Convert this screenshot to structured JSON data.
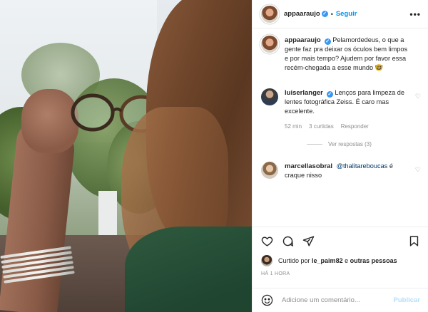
{
  "photo": {
    "alt": ""
  },
  "post": {
    "author": "appaaraujo",
    "follow_label": "Seguir",
    "more": "•••",
    "separator": "•"
  },
  "comments": [
    {
      "user": "appaaraujo",
      "text": "Pelamordedeus, o que a gente faz pra deixar os óculos bem limpos e por mais tempo? Ajudem por favor essa recém-chegada a esse mundo",
      "emoji": "🤓"
    },
    {
      "user": "luiserlanger",
      "text": "Lenços para limpeza de lentes fotográfica Zeiss. É caro mas excelente.",
      "time": "52 min",
      "likes": "3 curtidas",
      "reply": "Responder",
      "view_replies": "Ver respostas (3)"
    },
    {
      "user": "marcellasobral",
      "mention": "@thalitareboucas",
      "text": "é craque nisso"
    }
  ],
  "liked_by": {
    "prefix": "Curtido por",
    "user": "le_paim82",
    "suffix": "e",
    "others": "outras pessoas"
  },
  "timestamp": "HÁ 1 HORA",
  "add_comment": {
    "placeholder": "Adicione um comentário...",
    "post_label": "Publicar"
  },
  "colors": {
    "link_blue": "#0095f6",
    "verified_blue": "#3897f0",
    "muted": "#8e8e8e",
    "text": "#262626",
    "post_disabled": "#b2dffc"
  }
}
